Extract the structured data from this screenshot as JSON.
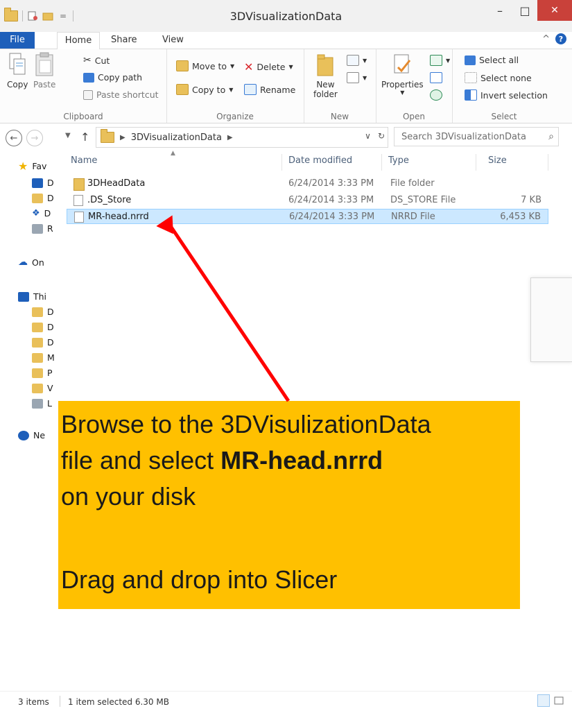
{
  "window": {
    "title": "3DVisualizationData",
    "minimize": "–",
    "maximize": "□",
    "close": "✕"
  },
  "tabs": {
    "file": "File",
    "home": "Home",
    "share": "Share",
    "view": "View",
    "collapse": "^",
    "help": "?"
  },
  "ribbon": {
    "clipboard": {
      "label": "Clipboard",
      "copy": "Copy",
      "paste": "Paste",
      "cut": "Cut",
      "copy_path": "Copy path",
      "paste_shortcut": "Paste shortcut"
    },
    "organize": {
      "label": "Organize",
      "move_to": "Move to",
      "copy_to": "Copy to",
      "delete": "Delete",
      "rename": "Rename"
    },
    "new": {
      "label": "New",
      "new_folder_line1": "New",
      "new_folder_line2": "folder"
    },
    "open": {
      "label": "Open",
      "properties": "Properties"
    },
    "select": {
      "label": "Select",
      "select_all": "Select all",
      "select_none": "Select none",
      "invert_selection": "Invert selection"
    }
  },
  "address": {
    "path": "3DVisualizationData",
    "search_placeholder": "Search 3DVisualizationData"
  },
  "nav_pane": {
    "favorites": "Fav",
    "favorites_items": [
      "D",
      "D",
      "D",
      "R"
    ],
    "onedrive": "On",
    "this_pc": "Thi",
    "this_pc_items": [
      "D",
      "D",
      "D",
      "M",
      "P",
      "V",
      "L"
    ],
    "network": "Ne"
  },
  "columns": {
    "name": "Name",
    "date": "Date modified",
    "type": "Type",
    "size": "Size"
  },
  "files": [
    {
      "name": "3DHeadData",
      "date": "6/24/2014 3:33 PM",
      "type": "File folder",
      "size": "",
      "kind": "folder"
    },
    {
      "name": ".DS_Store",
      "date": "6/24/2014 3:33 PM",
      "type": "DS_STORE File",
      "size": "7 KB",
      "kind": "file"
    },
    {
      "name": "MR-head.nrrd",
      "date": "6/24/2014 3:33 PM",
      "type": "NRRD File",
      "size": "6,453 KB",
      "kind": "file",
      "selected": true
    }
  ],
  "callout": {
    "line1": "Browse to the 3DVisulizationData",
    "line2_prefix": "file and select ",
    "line2_bold": "MR-head.nrrd",
    "line3": "on your disk",
    "line4": "Drag and drop into Slicer",
    "background_color": "#ffc000"
  },
  "annotation": {
    "arrow_color": "#ff0000"
  },
  "status": {
    "items": "3 items",
    "selected": "1 item selected  6.30 MB"
  }
}
